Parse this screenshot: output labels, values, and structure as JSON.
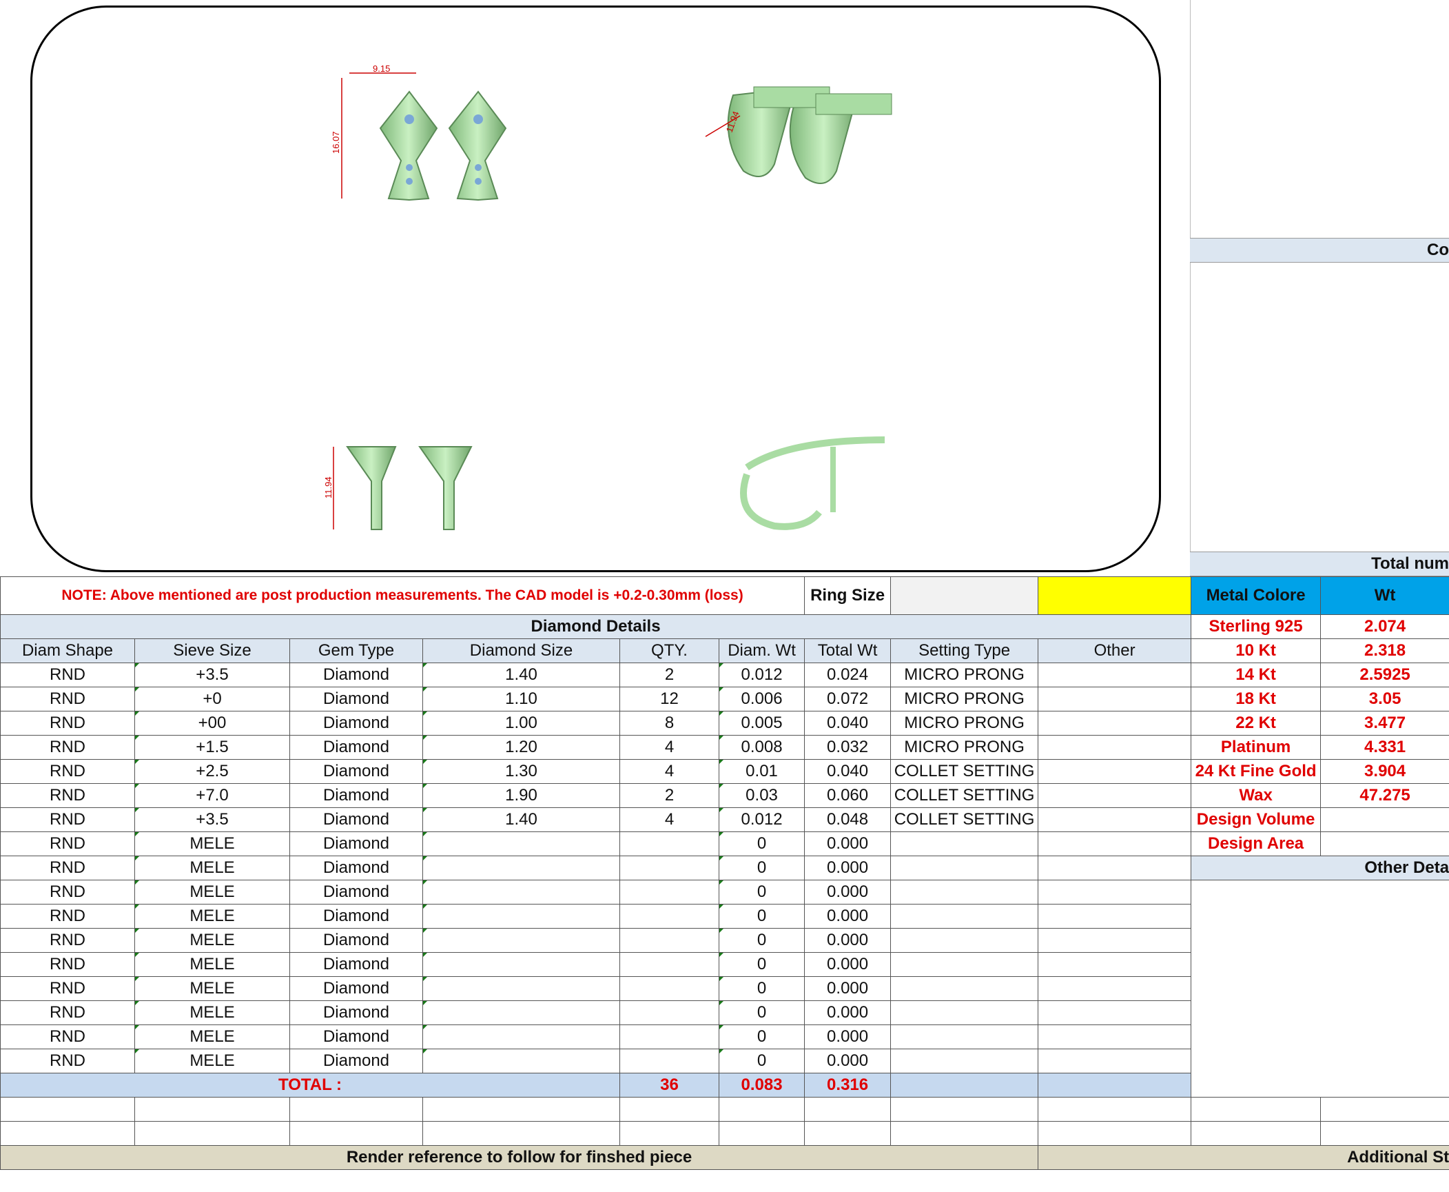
{
  "cad": {
    "top_dim": "9.15",
    "left_dim": "16.07",
    "side_dim": "11.94",
    "persp_dim": "11.94"
  },
  "side_panel": {
    "band1": "Co",
    "band2": "Total num",
    "band3": "Other Deta"
  },
  "note": "NOTE: Above mentioned are post production measurements. The CAD model is +0.2-0.30mm (loss)",
  "ring_size_label": "Ring Size",
  "ring_size_value": "",
  "section_title": "Diamond Details",
  "columns": [
    "Diam Shape",
    "Sieve Size",
    "Gem Type",
    "Diamond Size",
    "QTY.",
    "Diam. Wt",
    "Total Wt",
    "Setting Type",
    "Other"
  ],
  "rows": [
    [
      "RND",
      "+3.5",
      "Diamond",
      "1.40",
      "2",
      "0.012",
      "0.024",
      "MICRO PRONG",
      ""
    ],
    [
      "RND",
      "+0",
      "Diamond",
      "1.10",
      "12",
      "0.006",
      "0.072",
      "MICRO PRONG",
      ""
    ],
    [
      "RND",
      "+00",
      "Diamond",
      "1.00",
      "8",
      "0.005",
      "0.040",
      "MICRO PRONG",
      ""
    ],
    [
      "RND",
      "+1.5",
      "Diamond",
      "1.20",
      "4",
      "0.008",
      "0.032",
      "MICRO PRONG",
      ""
    ],
    [
      "RND",
      "+2.5",
      "Diamond",
      "1.30",
      "4",
      "0.01",
      "0.040",
      "COLLET SETTING",
      ""
    ],
    [
      "RND",
      "+7.0",
      "Diamond",
      "1.90",
      "2",
      "0.03",
      "0.060",
      "COLLET SETTING",
      ""
    ],
    [
      "RND",
      "+3.5",
      "Diamond",
      "1.40",
      "4",
      "0.012",
      "0.048",
      "COLLET SETTING",
      ""
    ],
    [
      "RND",
      "MELE",
      "Diamond",
      "",
      "",
      "0",
      "0.000",
      "",
      ""
    ],
    [
      "RND",
      "MELE",
      "Diamond",
      "",
      "",
      "0",
      "0.000",
      "",
      ""
    ],
    [
      "RND",
      "MELE",
      "Diamond",
      "",
      "",
      "0",
      "0.000",
      "",
      ""
    ],
    [
      "RND",
      "MELE",
      "Diamond",
      "",
      "",
      "0",
      "0.000",
      "",
      ""
    ],
    [
      "RND",
      "MELE",
      "Diamond",
      "",
      "",
      "0",
      "0.000",
      "",
      ""
    ],
    [
      "RND",
      "MELE",
      "Diamond",
      "",
      "",
      "0",
      "0.000",
      "",
      ""
    ],
    [
      "RND",
      "MELE",
      "Diamond",
      "",
      "",
      "0",
      "0.000",
      "",
      ""
    ],
    [
      "RND",
      "MELE",
      "Diamond",
      "",
      "",
      "0",
      "0.000",
      "",
      ""
    ],
    [
      "RND",
      "MELE",
      "Diamond",
      "",
      "",
      "0",
      "0.000",
      "",
      ""
    ],
    [
      "RND",
      "MELE",
      "Diamond",
      "",
      "",
      "0",
      "0.000",
      "",
      ""
    ]
  ],
  "total": {
    "label": "TOTAL :",
    "qty": "36",
    "diam_wt": "0.083",
    "total_wt": "0.316"
  },
  "metal": {
    "head_color": "Metal Colore",
    "head_wt": "Wt",
    "rows": [
      [
        "Sterling 925",
        "2.074"
      ],
      [
        "10 Kt",
        "2.318"
      ],
      [
        "14 Kt",
        "2.5925"
      ],
      [
        "18 Kt",
        "3.05"
      ],
      [
        "22 Kt",
        "3.477"
      ],
      [
        "Platinum",
        "4.331"
      ],
      [
        "24 Kt Fine Gold",
        "3.904"
      ],
      [
        "Wax",
        "47.275"
      ],
      [
        "Design Volume",
        ""
      ],
      [
        "Design Area",
        ""
      ]
    ]
  },
  "render_ref": "Render reference to follow for finshed piece",
  "additional": "Additional St",
  "colors": {
    "header_blue": "#dce6f1",
    "metal_head": "#00a2e8",
    "highlight": "#ffff00",
    "accent_red": "#e00000",
    "model_green": "#b5e3b0"
  }
}
